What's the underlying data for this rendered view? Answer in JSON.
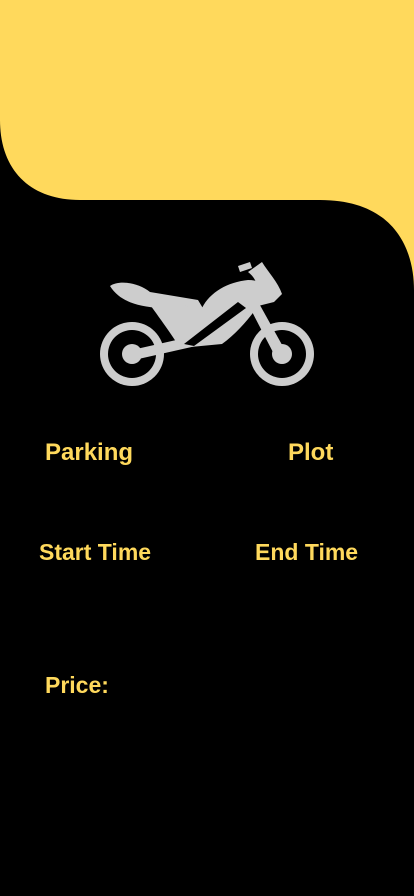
{
  "theme": {
    "accent": "#ffd95c",
    "background": "#000000",
    "icon_color": "#cdcdcd"
  },
  "header": {
    "icon": "motorcycle-icon"
  },
  "details": {
    "parking_label": "Parking",
    "plot_label": "Plot",
    "start_time_label": "Start Time",
    "end_time_label": "End Time",
    "price_label": "Price:"
  }
}
